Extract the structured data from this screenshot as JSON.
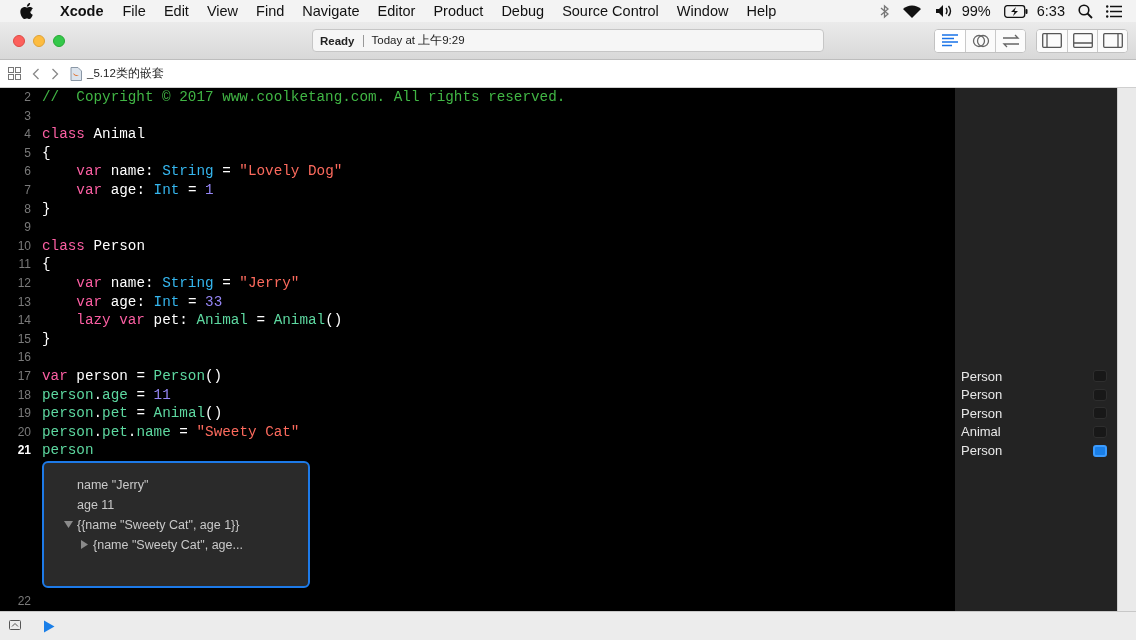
{
  "menu_bar": {
    "app": "Xcode",
    "menus": [
      "File",
      "Edit",
      "View",
      "Find",
      "Navigate",
      "Editor",
      "Product",
      "Debug",
      "Source Control",
      "Window",
      "Help"
    ],
    "battery": "99%",
    "clock": "6:33"
  },
  "toolbar": {
    "status": "Ready",
    "timestamp": "Today at 上午9:29",
    "editor_modes": [
      {
        "selected": true
      },
      {
        "selected": false
      },
      {
        "selected": false
      }
    ],
    "panels": [
      {
        "selected": false
      },
      {
        "selected": false
      },
      {
        "selected": false
      }
    ]
  },
  "jump_bar": {
    "file": "_5.12类的嵌套"
  },
  "editor": {
    "lines": [
      {
        "number": "2",
        "current": false,
        "tokens": [
          {
            "kind": "comment",
            "text": "//  Copyright © 2017 www.coolketang.com. All rights reserved."
          }
        ]
      },
      {
        "number": "3",
        "current": false
      },
      {
        "number": "4",
        "current": false,
        "tokens": [
          {
            "kind": "keyword",
            "text": "class"
          },
          {
            "kind": "plain",
            "text": " Animal"
          }
        ]
      },
      {
        "number": "5",
        "current": false,
        "tokens": [
          {
            "kind": "plain",
            "text": "{"
          }
        ]
      },
      {
        "number": "6",
        "current": false,
        "tokens": [
          {
            "kind": "keyword",
            "text": "    var"
          },
          {
            "kind": "plain",
            "text": " name: "
          },
          {
            "kind": "type",
            "text": "String"
          },
          {
            "kind": "plain",
            "text": " = "
          },
          {
            "kind": "string",
            "text": "\"Lovely Dog\""
          }
        ]
      },
      {
        "number": "7",
        "current": false,
        "tokens": [
          {
            "kind": "keyword",
            "text": "    var"
          },
          {
            "kind": "plain",
            "text": " age: "
          },
          {
            "kind": "type",
            "text": "Int"
          },
          {
            "kind": "plain",
            "text": " = "
          },
          {
            "kind": "number",
            "text": "1"
          }
        ]
      },
      {
        "number": "8",
        "current": false,
        "tokens": [
          {
            "kind": "plain",
            "text": "}"
          }
        ]
      },
      {
        "number": "9",
        "current": false
      },
      {
        "number": "10",
        "current": false,
        "tokens": [
          {
            "kind": "keyword",
            "text": "class"
          },
          {
            "kind": "plain",
            "text": " Person"
          }
        ]
      },
      {
        "number": "11",
        "current": false,
        "tokens": [
          {
            "kind": "plain",
            "text": "{"
          }
        ]
      },
      {
        "number": "12",
        "current": false,
        "tokens": [
          {
            "kind": "keyword",
            "text": "    var"
          },
          {
            "kind": "plain",
            "text": " name: "
          },
          {
            "kind": "type",
            "text": "String"
          },
          {
            "kind": "plain",
            "text": " = "
          },
          {
            "kind": "string",
            "text": "\"Jerry\""
          }
        ]
      },
      {
        "number": "13",
        "current": false,
        "tokens": [
          {
            "kind": "keyword",
            "text": "    var"
          },
          {
            "kind": "plain",
            "text": " age: "
          },
          {
            "kind": "type",
            "text": "Int"
          },
          {
            "kind": "plain",
            "text": " = "
          },
          {
            "kind": "number",
            "text": "33"
          }
        ]
      },
      {
        "number": "14",
        "current": false,
        "tokens": [
          {
            "kind": "keyword",
            "text": "    lazy var"
          },
          {
            "kind": "plain",
            "text": " pet: "
          },
          {
            "kind": "project",
            "text": "Animal"
          },
          {
            "kind": "plain",
            "text": " = "
          },
          {
            "kind": "project",
            "text": "Animal"
          },
          {
            "kind": "plain",
            "text": "()"
          }
        ]
      },
      {
        "number": "15",
        "current": false,
        "tokens": [
          {
            "kind": "plain",
            "text": "}"
          }
        ]
      },
      {
        "number": "16",
        "current": false
      },
      {
        "number": "17",
        "current": false,
        "tokens": [
          {
            "kind": "keyword",
            "text": "var"
          },
          {
            "kind": "plain",
            "text": " person = "
          },
          {
            "kind": "project",
            "text": "Person"
          },
          {
            "kind": "plain",
            "text": "()"
          }
        ],
        "result": {
          "label": "Person",
          "selected": false
        }
      },
      {
        "number": "18",
        "current": false,
        "tokens": [
          {
            "kind": "project",
            "text": "person"
          },
          {
            "kind": "plain",
            "text": "."
          },
          {
            "kind": "project",
            "text": "age"
          },
          {
            "kind": "plain",
            "text": " = "
          },
          {
            "kind": "number",
            "text": "11"
          }
        ],
        "result": {
          "label": "Person",
          "selected": false
        }
      },
      {
        "number": "19",
        "current": false,
        "tokens": [
          {
            "kind": "project",
            "text": "person"
          },
          {
            "kind": "plain",
            "text": "."
          },
          {
            "kind": "project",
            "text": "pet"
          },
          {
            "kind": "plain",
            "text": " = "
          },
          {
            "kind": "project",
            "text": "Animal"
          },
          {
            "kind": "plain",
            "text": "()"
          }
        ],
        "result": {
          "label": "Person",
          "selected": false
        }
      },
      {
        "number": "20",
        "current": false,
        "tokens": [
          {
            "kind": "project",
            "text": "person"
          },
          {
            "kind": "plain",
            "text": "."
          },
          {
            "kind": "project",
            "text": "pet"
          },
          {
            "kind": "plain",
            "text": "."
          },
          {
            "kind": "project",
            "text": "name"
          },
          {
            "kind": "plain",
            "text": " = "
          },
          {
            "kind": "string",
            "text": "\"Sweety Cat\""
          }
        ],
        "result": {
          "label": "Animal",
          "selected": false
        }
      },
      {
        "number": "21",
        "current": true,
        "tokens": [
          {
            "kind": "project",
            "text": "person"
          }
        ],
        "result": {
          "label": "Person",
          "selected": true
        },
        "popover": {
          "rows": [
            {
              "text": "name \"Jerry\""
            },
            {
              "text": "age 11"
            },
            {
              "text": "{{name \"Sweety Cat\", age 1}}",
              "expanded": true,
              "children": [
                {
                  "text": "{name \"Sweety Cat\", age...",
                  "expanded": false
                }
              ]
            }
          ]
        }
      },
      {
        "number": "22",
        "current": false
      }
    ]
  }
}
